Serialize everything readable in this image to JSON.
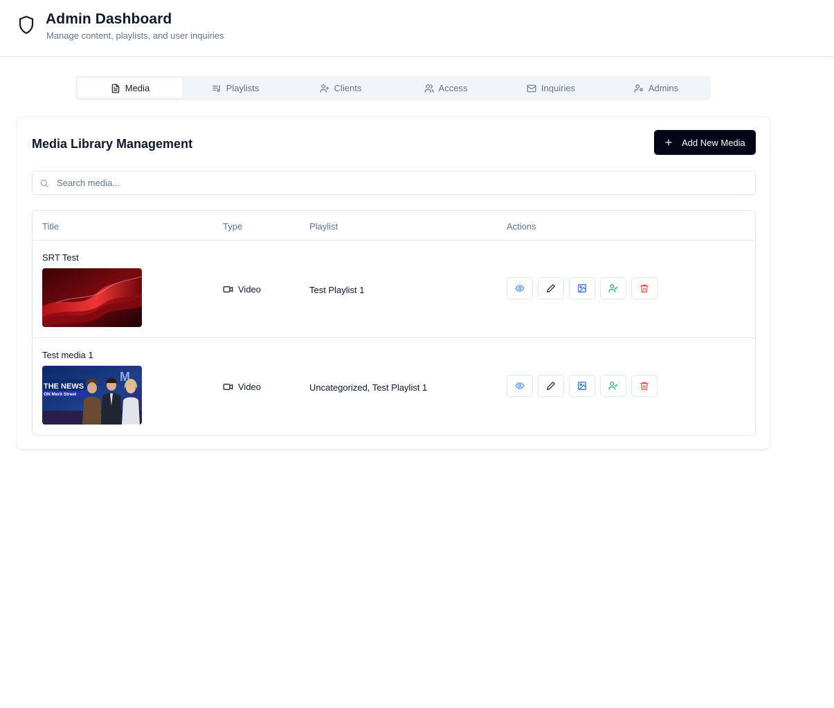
{
  "header": {
    "title": "Admin Dashboard",
    "subtitle": "Manage content, playlists, and user inquiries",
    "icon": "shield-icon"
  },
  "tabs": [
    {
      "label": "Media",
      "icon": "file-text-icon",
      "active": true
    },
    {
      "label": "Playlists",
      "icon": "list-music-icon",
      "active": false
    },
    {
      "label": "Clients",
      "icon": "user-plus-icon",
      "active": false
    },
    {
      "label": "Access",
      "icon": "users-icon",
      "active": false
    },
    {
      "label": "Inquiries",
      "icon": "mail-icon",
      "active": false
    },
    {
      "label": "Admins",
      "icon": "user-cog-icon",
      "active": false
    }
  ],
  "main": {
    "title": "Media Library Management",
    "add_button": "Add New Media",
    "search_placeholder": "Search media..."
  },
  "table": {
    "columns": [
      "Title",
      "Type",
      "Playlist",
      "Actions"
    ],
    "rows": [
      {
        "title": "SRT Test",
        "type": "Video",
        "playlist": "Test Playlist 1",
        "thumbnail": "red-abstract-wave"
      },
      {
        "title": "Test media 1",
        "type": "Video",
        "playlist": "Uncategorized, Test Playlist 1",
        "thumbnail": "news-anchors",
        "thumbnail_text": {
          "brand": "THE NEWS",
          "sub": "ON Merit Street"
        }
      }
    ],
    "actions": [
      {
        "name": "view",
        "icon": "eye-icon",
        "color": "#3b82f6"
      },
      {
        "name": "edit",
        "icon": "pencil-icon",
        "color": "#0f172a"
      },
      {
        "name": "thumbnail",
        "icon": "image-icon",
        "color": "#2563eb"
      },
      {
        "name": "assign",
        "icon": "user-check-icon",
        "color": "#16a34a"
      },
      {
        "name": "delete",
        "icon": "trash-icon",
        "color": "#ef4444"
      }
    ]
  }
}
